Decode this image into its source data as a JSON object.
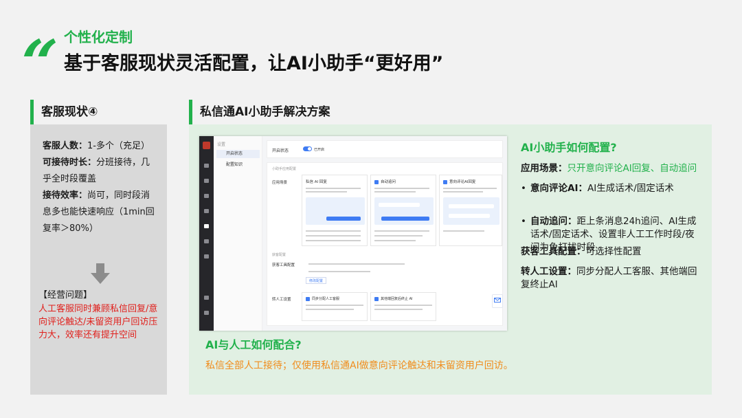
{
  "header": {
    "subtitle": "个性化定制",
    "title": "基于客服现状灵活配置，让AI小助手“更好用”"
  },
  "left_panel": {
    "heading": "客服现状④",
    "stats": [
      {
        "label": "客服人数：",
        "value": "1-多个（充足）"
      },
      {
        "label": "可接待时长：",
        "value": "分班接待，几乎全时段覆盖"
      },
      {
        "label": "接待效率：",
        "value": "尚可，同时段消息多也能快速响应（1min回复率＞80%）"
      }
    ],
    "issue_title": "【经营问题】",
    "issue_text": "人工客服同时兼顾私信回复/意向评论触达/未留资用户回访压力大，效率还有提升空间"
  },
  "right_panel": {
    "heading": "私信通AI小助手解决方案",
    "config_question": "AI小助手如何配置?",
    "scene_label": "应用场景：",
    "scene_value": "只开意向评论AI回复、自动追问",
    "bullets": [
      {
        "label": "意向评论AI：",
        "value": "AI生成话术/固定话术"
      },
      {
        "label": "自动追问：",
        "value": "距上条消息24h追问、AI生成话术/固定话术、设置非人工工作时段/夜间为免打扰时段"
      }
    ],
    "tool_label": "获客工具配置：",
    "tool_value": "可选择性配置",
    "transfer_label": "转人工设置：",
    "transfer_value": "同步分配人工客服、其他端回复终止AI",
    "coop_question": "AI与人工如何配合?",
    "coop_answer": "私信全部人工接待；仅使用私信通AI做意向评论触达和未留资用户回访。"
  },
  "screenshot": {
    "nav_header": "设置",
    "nav_items": [
      "开启状态",
      "配置知识"
    ],
    "status_label": "开启状态",
    "status_value": "已开启",
    "section_label": "小助手应用配置",
    "scene_label": "应用场景",
    "cards": [
      "私信 AI 回复",
      "自动追问",
      "意向评论AI回复"
    ],
    "tool_section": "获客配置",
    "tool_label": "获客工具配置",
    "tool_button": "修改配置",
    "transfer_label": "转人工设置",
    "transfer_opts": [
      "同步分配人工客服",
      "其他端回复后终止 AI"
    ]
  },
  "colors": {
    "accent": "#22b14c",
    "warning": "#e0201c",
    "answer": "#f08c1c"
  }
}
